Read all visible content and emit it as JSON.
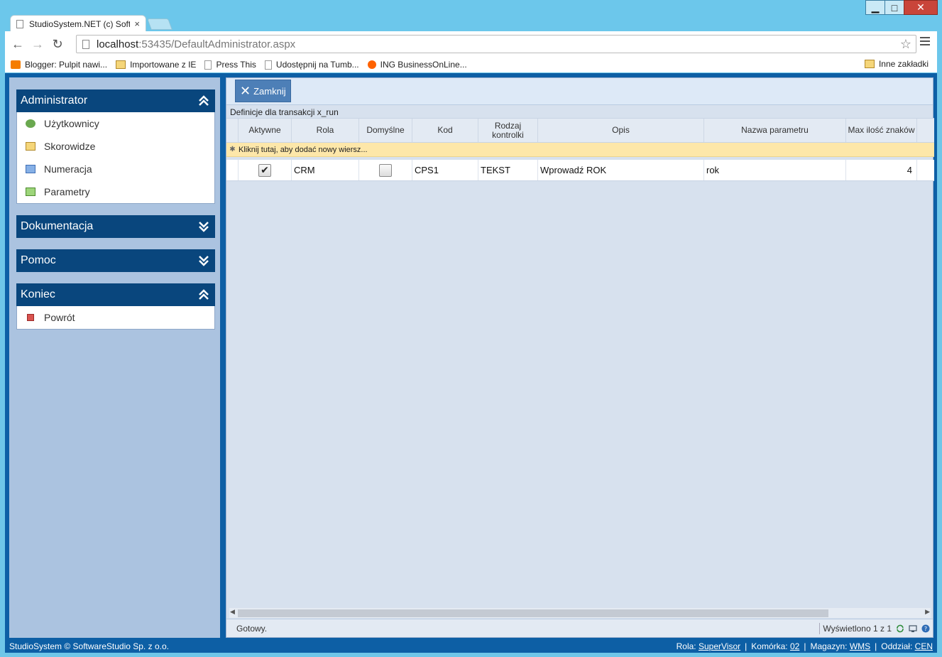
{
  "browser": {
    "tab_title": "StudioSystem.NET (c) Soft",
    "tab_close": "×",
    "url_host": "localhost",
    "url_path": ":53435/DefaultAdministrator.aspx",
    "bookmarks": [
      {
        "label": "Blogger: Pulpit nawi...",
        "icon": "blogger-icon"
      },
      {
        "label": "Importowane z IE",
        "icon": "folder-icon"
      },
      {
        "label": "Press This",
        "icon": "page-icon"
      },
      {
        "label": "Udostępnij na Tumb...",
        "icon": "page-icon"
      },
      {
        "label": "ING BusinessOnLine...",
        "icon": "ing-icon"
      }
    ],
    "other_bookmarks": "Inne zakładki"
  },
  "sidebar": {
    "panels": [
      {
        "title": "Administrator",
        "expanded": true,
        "items": [
          "Użytkownicy",
          "Skorowidze",
          "Numeracja",
          "Parametry"
        ]
      },
      {
        "title": "Dokumentacja",
        "expanded": false
      },
      {
        "title": "Pomoc",
        "expanded": false
      },
      {
        "title": "Koniec",
        "expanded": true,
        "items": [
          "Powrót"
        ]
      }
    ]
  },
  "main": {
    "close_button": "Zamknij",
    "caption": "Definicje dla transakcji x_run",
    "columns": [
      "Aktywne",
      "Rola",
      "Domyślne",
      "Kod",
      "Rodzaj kontrolki",
      "Opis",
      "Nazwa parametru",
      "Max ilość znaków"
    ],
    "add_row_text": "Kliknij tutaj, aby dodać nowy wiersz...",
    "rows": [
      {
        "aktywne": true,
        "rola": "CRM",
        "domyslne": false,
        "kod": "CPS1",
        "rodzaj": "TEKST",
        "opis": "Wprowadź ROK",
        "nazwa": "rok",
        "max": "4"
      }
    ],
    "status": "Gotowy.",
    "shown": "Wyświetlono 1 z 1"
  },
  "footer": {
    "left": "StudioSystem © SoftwareStudio Sp. z o.o.",
    "rola_label": "Rola:",
    "rola_value": "SuperVisor",
    "komorka_label": "Komórka:",
    "komorka_value": "02",
    "magazyn_label": "Magazyn:",
    "magazyn_value": "WMS",
    "oddzial_label": "Oddział:",
    "oddzial_value": "CEN"
  }
}
